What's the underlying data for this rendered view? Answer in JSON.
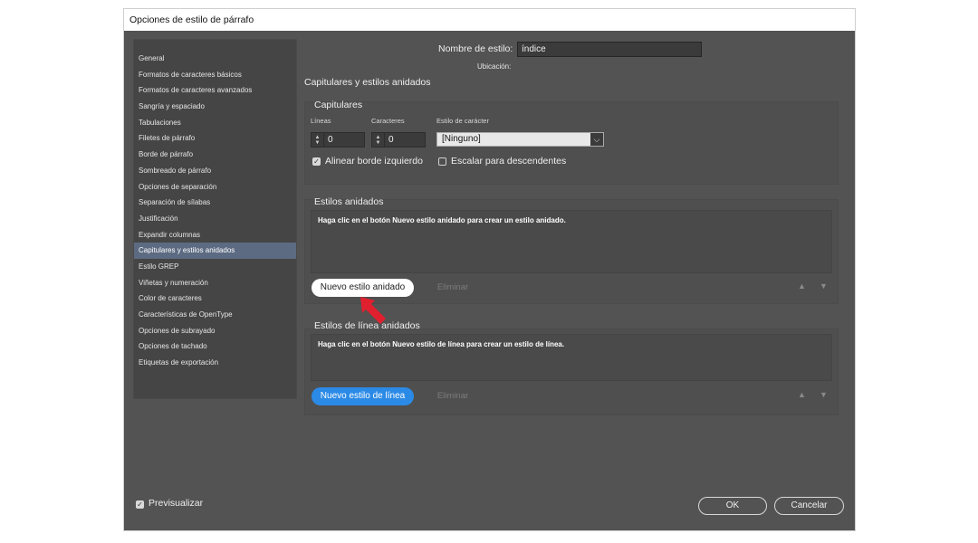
{
  "window": {
    "title": "Opciones de estilo de párrafo"
  },
  "sidebar": {
    "items": [
      "General",
      "Formatos de caracteres básicos",
      "Formatos de caracteres avanzados",
      "Sangría y espaciado",
      "Tabulaciones",
      "Filetes de párrafo",
      "Borde de párrafo",
      "Sombreado de párrafo",
      "Opciones de separación",
      "Separación de sílabas",
      "Justificación",
      "Expandir columnas",
      "Capitulares y estilos anidados",
      "Estilo GREP",
      "Viñetas y numeración",
      "Color de caracteres",
      "Características de OpenType",
      "Opciones de subrayado",
      "Opciones de tachado",
      "Etiquetas de exportación"
    ],
    "selected_index": 12
  },
  "header": {
    "style_name_label": "Nombre de estilo:",
    "style_name_value": "índice",
    "location_label": "Ubicación:"
  },
  "section": {
    "title": "Capitulares y estilos anidados"
  },
  "dropcaps": {
    "title": "Capitulares",
    "lines_label": "Líneas",
    "lines_value": "0",
    "chars_label": "Caracteres",
    "chars_value": "0",
    "char_style_label": "Estilo de carácter",
    "char_style_value": "[Ninguno]",
    "align_left_label": "Alinear borde izquierdo",
    "align_left_checked": true,
    "scale_desc_label": "Escalar para descendentes",
    "scale_desc_checked": false
  },
  "nested": {
    "title": "Estilos anidados",
    "hint": "Haga clic en el botón Nuevo estilo anidado para crear un estilo anidado.",
    "new_button": "Nuevo estilo anidado",
    "delete_button": "Eliminar"
  },
  "nested_lines": {
    "title": "Estilos de línea anidados",
    "hint": "Haga clic en el botón Nuevo estilo de línea para crear un estilo de línea.",
    "new_button": "Nuevo estilo de línea",
    "delete_button": "Eliminar"
  },
  "footer": {
    "preview_label": "Previsualizar",
    "preview_checked": true,
    "ok_button": "OK",
    "cancel_button": "Cancelar"
  },
  "colors": {
    "dialog_bg": "#535353",
    "selected_item": "#5c6b82",
    "primary_button": "#2b8ae6",
    "annotation_arrow": "#e0202e"
  }
}
